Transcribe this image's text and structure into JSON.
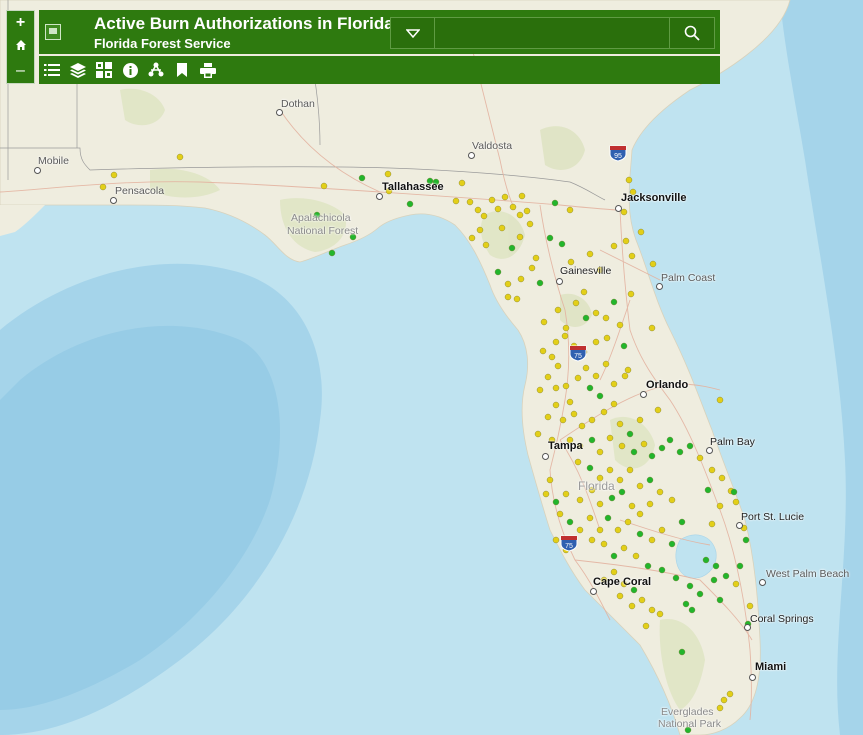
{
  "app": {
    "title": "Active Burn Authorizations in Florida",
    "subtitle": "Florida Forest Service"
  },
  "search": {
    "placeholder": "",
    "value": ""
  },
  "icons": {
    "zoom_in": "plus-icon",
    "home": "home-icon",
    "zoom_out": "minus-icon",
    "dropdown": "chevron-down-icon",
    "search": "search-icon",
    "legend": "list-icon",
    "layers": "layers-icon",
    "basemap": "basemap-gallery-icon",
    "about": "info-icon",
    "share": "share-icon",
    "bookmarks": "bookmark-icon",
    "print": "print-icon"
  },
  "zoom": {
    "in_label": "+",
    "out_label": "–"
  },
  "colors": {
    "header": "#2e7a0f",
    "water": "#bfe3f0",
    "land": "#efeddf",
    "marker_yellow": "#e3cf18",
    "marker_green": "#22b52c"
  },
  "map": {
    "labels": {
      "dothan": "Dothan",
      "mobile": "Mobile",
      "pensacola": "Pensacola",
      "valdosta": "Valdosta",
      "tallahassee": "Tallahassee",
      "jacksonville": "Jacksonville",
      "apalachicola1": "Apalachicola",
      "apalachicola2": "National Forest",
      "gainesville": "Gainesville",
      "palm_coast": "Palm Coast",
      "orlando": "Orlando",
      "palm_bay": "Palm Bay",
      "tampa": "Tampa",
      "florida": "Florida",
      "port_st_lucie": "Port St. Lucie",
      "west_palm_beach": "West Palm Beach",
      "cape_coral": "Cape Coral",
      "coral_springs": "Coral Springs",
      "miami": "Miami",
      "everglades1": "Everglades",
      "everglades2": "National Park"
    },
    "shields": {
      "i95": "95",
      "i75_north": "75",
      "i75_south": "75"
    }
  }
}
